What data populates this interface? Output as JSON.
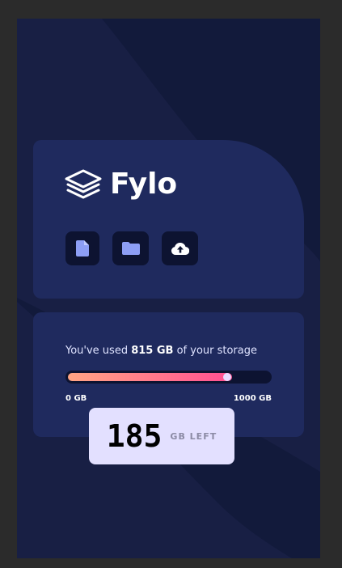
{
  "brand": {
    "name": "Fylo",
    "logo_icon": "layers-icon"
  },
  "toolbar": {
    "buttons": [
      {
        "icon": "document-icon"
      },
      {
        "icon": "folder-icon"
      },
      {
        "icon": "cloud-upload-icon"
      }
    ]
  },
  "storage": {
    "prefix": "You've used ",
    "used": "815 GB",
    "suffix": " of your storage",
    "min_label": "0 GB",
    "max_label": "1000 GB",
    "used_fraction": 0.815,
    "remaining_value": "185",
    "remaining_label": "GB LEFT"
  },
  "colors": {
    "background": "#181f44",
    "card": "#1f2a5e",
    "gradient_start": "#ffa584",
    "gradient_end": "#ff4f91",
    "badge": "#e3e0ff"
  }
}
